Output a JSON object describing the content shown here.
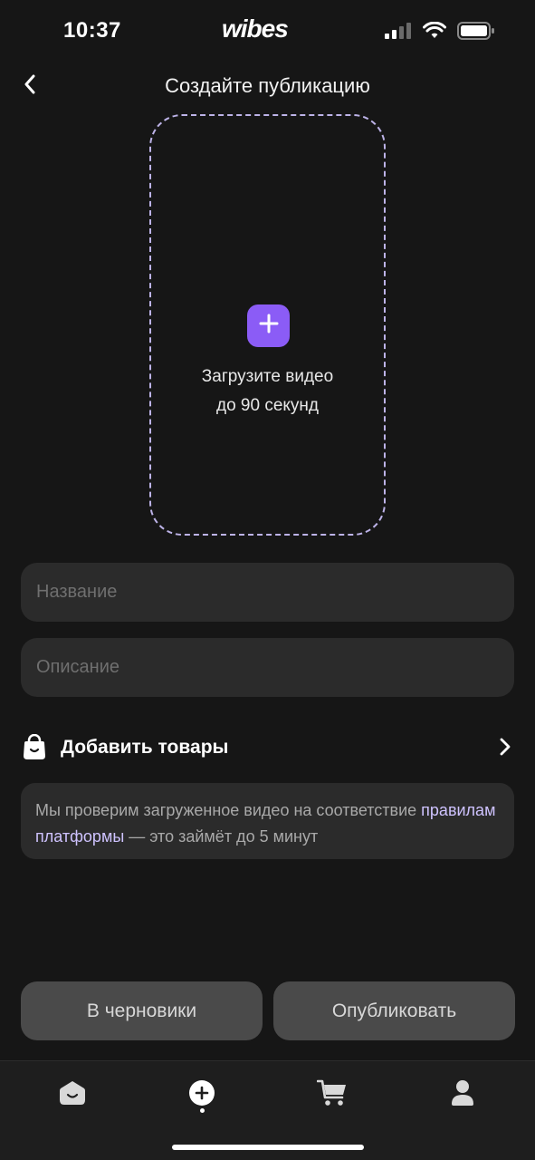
{
  "status_bar": {
    "time": "10:37",
    "logo": "wibes",
    "icons": [
      "signal-icon",
      "wifi-icon",
      "battery-icon"
    ]
  },
  "header": {
    "title": "Создайте публикацию",
    "back_icon": "chevron-left-icon"
  },
  "upload": {
    "icon": "plus-icon",
    "line1": "Загрузите видео",
    "line2": "до 90 секунд",
    "accent_color": "#8b5cf6",
    "border_color": "#bdb3e8"
  },
  "form": {
    "title_placeholder": "Название",
    "description_placeholder": "Описание"
  },
  "add_products": {
    "icon": "shopping-bag-icon",
    "label": "Добавить товары",
    "chevron": "chevron-right-icon"
  },
  "notice": {
    "text_before": "Мы проверим загруженное видео на соответствие ",
    "link_text": "правилам платформы",
    "text_after": " — это займёт до 5 минут",
    "link_color": "#cfc3ff"
  },
  "actions": {
    "drafts_label": "В черновики",
    "publish_label": "Опубликовать"
  },
  "tab_bar": {
    "items": [
      {
        "icon": "home-icon",
        "active": false
      },
      {
        "icon": "create-plus-icon",
        "active": true
      },
      {
        "icon": "cart-icon",
        "active": false
      },
      {
        "icon": "profile-icon",
        "active": false
      }
    ]
  }
}
